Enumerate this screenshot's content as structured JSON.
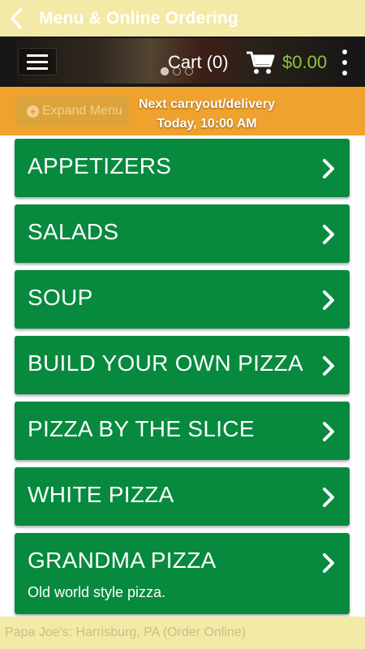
{
  "app": {
    "title": "Menu & Online Ordering"
  },
  "header": {
    "cart_label": "Cart (0)",
    "cart_total": "$0.00",
    "carousel_dots": 3,
    "carousel_active": 0
  },
  "strip": {
    "expand_label": "Expand Menu",
    "next_line1": "Next carryout/delivery",
    "next_line2": "Today, 10:00 AM"
  },
  "menu": {
    "items": [
      {
        "label": "APPETIZERS",
        "desc": ""
      },
      {
        "label": "SALADS",
        "desc": ""
      },
      {
        "label": "SOUP",
        "desc": ""
      },
      {
        "label": "BUILD YOUR OWN PIZZA",
        "desc": ""
      },
      {
        "label": "PIZZA BY THE SLICE",
        "desc": ""
      },
      {
        "label": "WHITE PIZZA",
        "desc": ""
      },
      {
        "label": "GRANDMA PIZZA",
        "desc": "Old world style pizza."
      }
    ]
  },
  "footer": {
    "text": "Papa Joe's: Harrisburg, PA (Order Online)"
  },
  "colors": {
    "titlebar": "#f4eaa7",
    "strip": "#f0a22e",
    "menu_item": "#078a3e",
    "cart_total": "#8cc63f"
  },
  "icons": {
    "back": "chevron-left-icon",
    "menu": "hamburger-icon",
    "cart": "shopping-cart-icon",
    "overflow": "kebab-icon",
    "chevron": "chevron-right-icon",
    "expand": "plus-circle-icon"
  }
}
